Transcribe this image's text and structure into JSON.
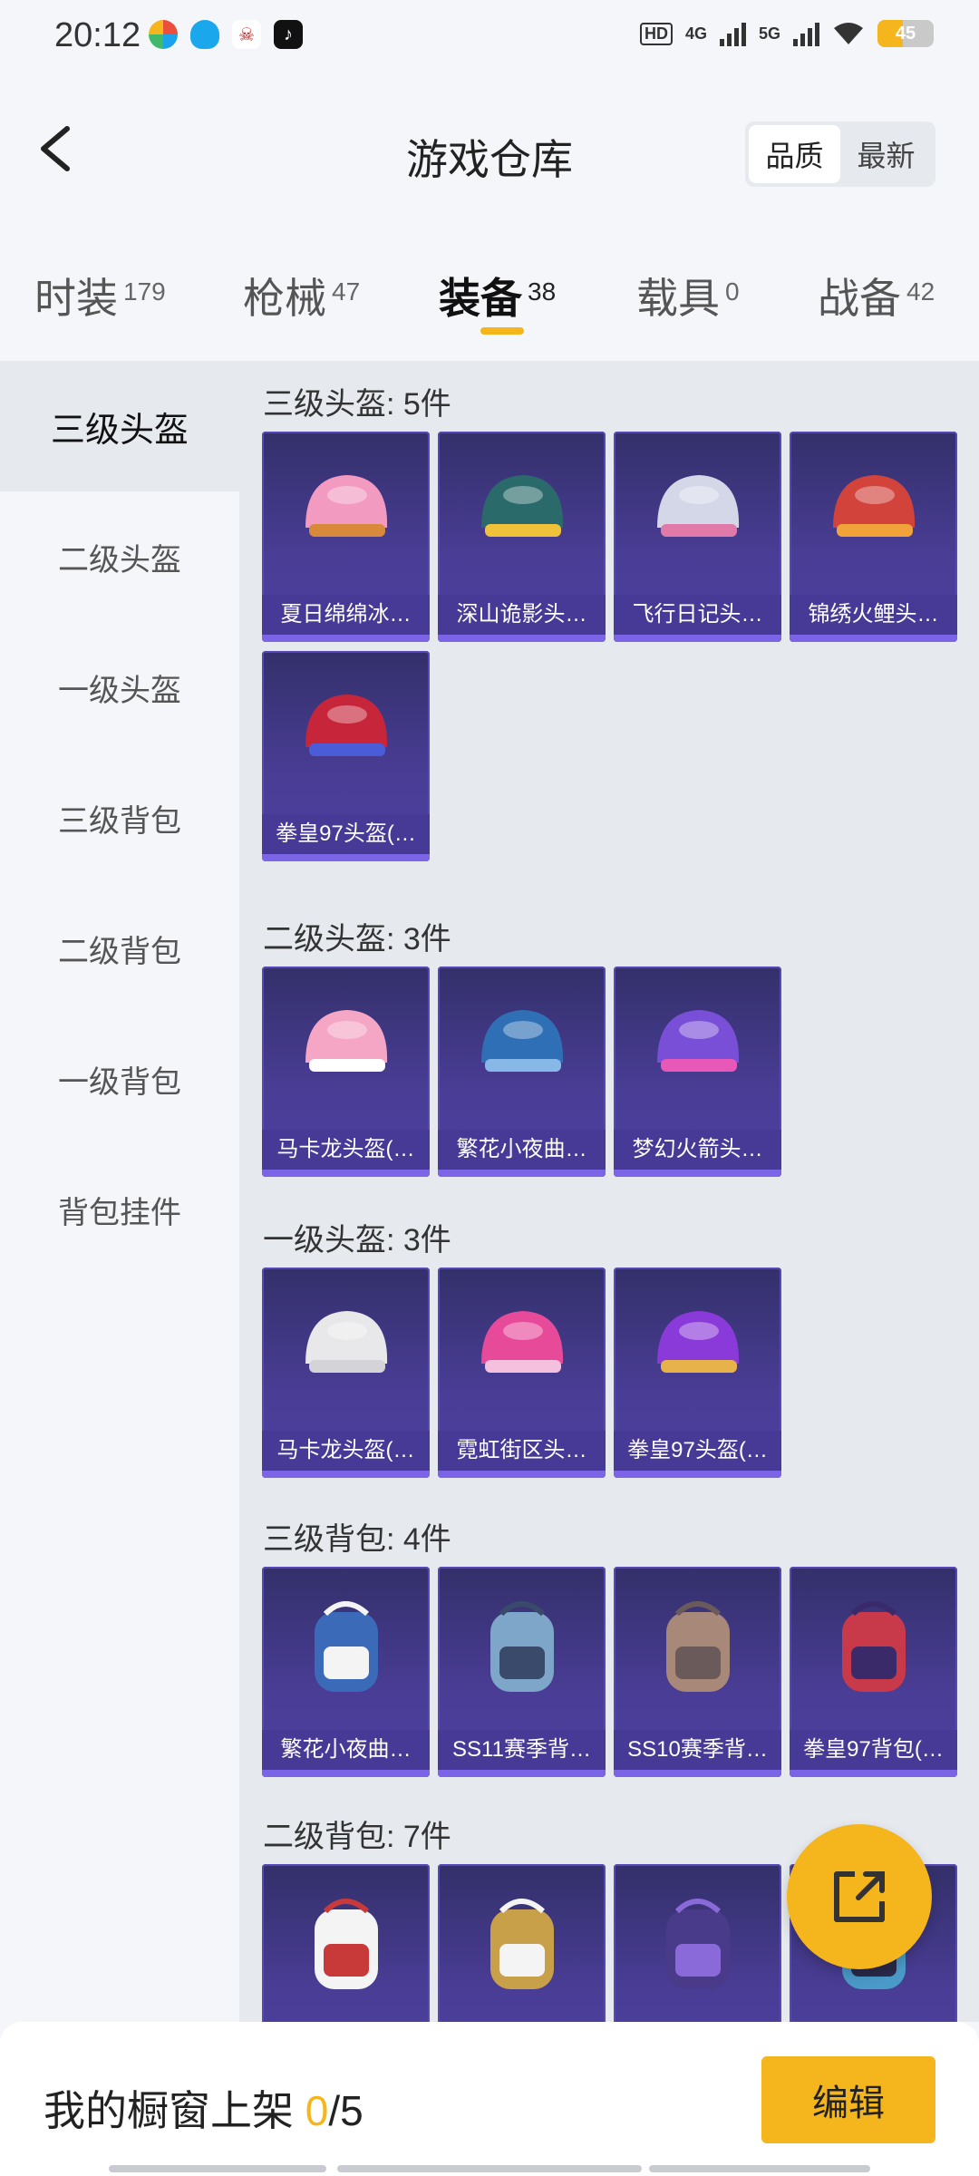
{
  "status_bar": {
    "time": "20:12",
    "network_1": "4G",
    "network_2": "5G",
    "battery": "45",
    "battery_level": 0.45
  },
  "header": {
    "title": "游戏仓库",
    "sort_options": [
      "品质",
      "最新"
    ],
    "sort_active": "品质"
  },
  "tabs": [
    {
      "label": "时装",
      "count": "179"
    },
    {
      "label": "枪械",
      "count": "47"
    },
    {
      "label": "装备",
      "count": "38",
      "active": true
    },
    {
      "label": "载具",
      "count": "0"
    },
    {
      "label": "战备",
      "count": "42"
    }
  ],
  "sidebar": [
    "三级头盔",
    "二级头盔",
    "一级头盔",
    "三级背包",
    "二级背包",
    "一级背包",
    "背包挂件"
  ],
  "sections": [
    {
      "title": "三级头盔: 5件",
      "items": [
        "夏日绵绵冰…",
        "深山诡影头…",
        "飞行日记头…",
        "锦绣火鲤头…",
        "拳皇97头盔(…"
      ]
    },
    {
      "title": "二级头盔: 3件",
      "items": [
        "马卡龙头盔(…",
        "繁花小夜曲…",
        "梦幻火箭头…"
      ]
    },
    {
      "title": "一级头盔: 3件",
      "items": [
        "马卡龙头盔(…",
        "霓虹街区头…",
        "拳皇97头盔(…"
      ]
    },
    {
      "title": "三级背包: 4件",
      "items": [
        "繁花小夜曲…",
        "SS11赛季背…",
        "SS10赛季背…",
        "拳皇97背包(…"
      ]
    },
    {
      "title": "二级背包: 7件",
      "items": [
        "",
        "",
        "",
        ""
      ]
    }
  ],
  "bottom": {
    "label": "我的橱窗上架 ",
    "current": "0",
    "total": "/5",
    "edit_label": "编辑"
  },
  "colors": {
    "accent": "#f5b51c",
    "card": "#4a3d96"
  }
}
